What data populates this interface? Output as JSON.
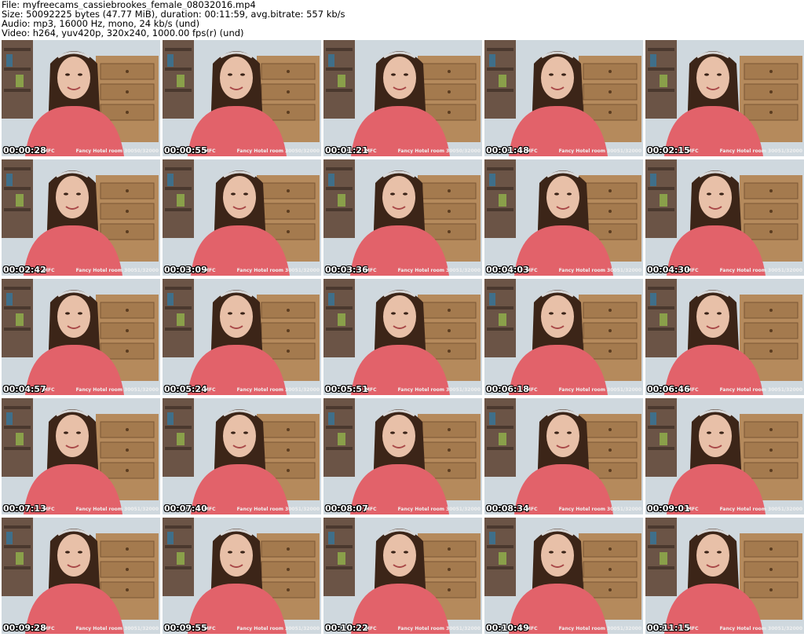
{
  "header": {
    "file": "File: myfreecams_cassiebrookes_female_08032016.mp4",
    "size": "Size: 50092225 bytes (47.77 MiB), duration: 00:11:59, avg.bitrate: 557 kb/s",
    "audio": "Audio: mp3, 16000 Hz, mono, 24 kb/s (und)",
    "video": "Video: h264, yuv420p, 320x240, 1000.00 fps(r) (und)"
  },
  "colors": {
    "sweater": "#e2626a",
    "wall": "#cfd8de",
    "dresser": "#b58a5c",
    "hair": "#3c2518",
    "skin": "#e8c0a8"
  },
  "thumbnails": [
    {
      "time": "00:00:28",
      "mfc": "MFC",
      "room": "Fancy Hotel room 30050/32000"
    },
    {
      "time": "00:00:55",
      "mfc": "MFC",
      "room": "Fancy Hotel room 30050/32000"
    },
    {
      "time": "00:01:21",
      "mfc": "MFC",
      "room": "Fancy Hotel room 30050/32000"
    },
    {
      "time": "00:01:48",
      "mfc": "MFC",
      "room": "Fancy Hotel room 30051/32000"
    },
    {
      "time": "00:02:15",
      "mfc": "MFC",
      "room": "Fancy Hotel room 30051/32000"
    },
    {
      "time": "00:02:42",
      "mfc": "MFC",
      "room": "Fancy Hotel room 30051/32000"
    },
    {
      "time": "00:03:09",
      "mfc": "MFC",
      "room": "Fancy Hotel room 30051/32000"
    },
    {
      "time": "00:03:36",
      "mfc": "MFC",
      "room": "Fancy Hotel room 30051/32000"
    },
    {
      "time": "00:04:03",
      "mfc": "MFC",
      "room": "Fancy Hotel room 30051/32000"
    },
    {
      "time": "00:04:30",
      "mfc": "MFC",
      "room": "Fancy Hotel room 30051/32000"
    },
    {
      "time": "00:04:57",
      "mfc": "MFC",
      "room": "Fancy Hotel room 30051/32000"
    },
    {
      "time": "00:05:24",
      "mfc": "MFC",
      "room": "Fancy Hotel room 30051/32000"
    },
    {
      "time": "00:05:51",
      "mfc": "MFC",
      "room": "Fancy Hotel room 30051/32000"
    },
    {
      "time": "00:06:18",
      "mfc": "MFC",
      "room": "Fancy Hotel room 30051/32000"
    },
    {
      "time": "00:06:46",
      "mfc": "MFC",
      "room": "Fancy Hotel room 30051/32000"
    },
    {
      "time": "00:07:13",
      "mfc": "MFC",
      "room": "Fancy Hotel room 30051/32000"
    },
    {
      "time": "00:07:40",
      "mfc": "MFC",
      "room": "Fancy Hotel room 30051/32000"
    },
    {
      "time": "00:08:07",
      "mfc": "MFC",
      "room": "Fancy Hotel room 30051/32000"
    },
    {
      "time": "00:08:34",
      "mfc": "MFC",
      "room": "Fancy Hotel room 30051/32000"
    },
    {
      "time": "00:09:01",
      "mfc": "MFC",
      "room": "Fancy Hotel room 30051/32000"
    },
    {
      "time": "00:09:28",
      "mfc": "MFC",
      "room": "Fancy Hotel room 30051/32000"
    },
    {
      "time": "00:09:55",
      "mfc": "MFC",
      "room": "Fancy Hotel room 30051/32000"
    },
    {
      "time": "00:10:22",
      "mfc": "MFC",
      "room": "Fancy Hotel room 30051/32000"
    },
    {
      "time": "00:10:49",
      "mfc": "MFC",
      "room": "Fancy Hotel room 30051/32000"
    },
    {
      "time": "00:11:15",
      "mfc": "MFC",
      "room": "Fancy Hotel room 30051/32000"
    }
  ]
}
